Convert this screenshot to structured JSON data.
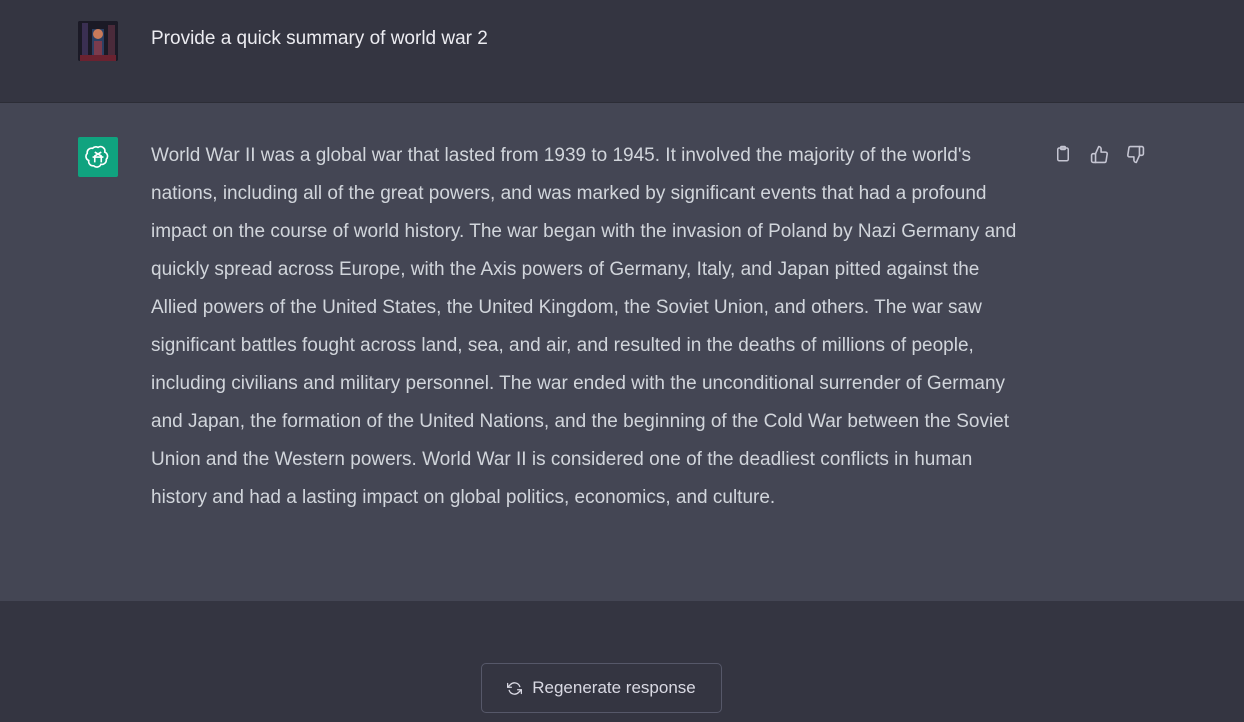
{
  "user_message": {
    "text": "Provide a quick summary of world war 2",
    "avatar_icon": "user-avatar-image"
  },
  "assistant_message": {
    "avatar_icon": "openai-logo-icon",
    "avatar_color": "#10a37f",
    "text": "World War II was a global war that lasted from 1939 to 1945. It involved the majority of the world's nations, including all of the great powers, and was marked by significant events that had a profound impact on the course of world history. The war began with the invasion of Poland by Nazi Germany and quickly spread across Europe, with the Axis powers of Germany, Italy, and Japan pitted against the Allied powers of the United States, the United Kingdom, the Soviet Union, and others. The war saw significant battles fought across land, sea, and air, and resulted in the deaths of millions of people, including civilians and military personnel. The war ended with the unconditional surrender of Germany and Japan, the formation of the United Nations, and the beginning of the Cold War between the Soviet Union and the Western powers. World War II is considered one of the deadliest conflicts in human history and had a lasting impact on global politics, economics, and culture.",
    "actions": [
      "clipboard-icon",
      "thumbs-up-icon",
      "thumbs-down-icon"
    ]
  },
  "regenerate": {
    "label": "Regenerate response",
    "icon": "refresh-icon"
  },
  "colors": {
    "background": "#343541",
    "assistant_background": "#444654",
    "accent": "#10a37f"
  }
}
